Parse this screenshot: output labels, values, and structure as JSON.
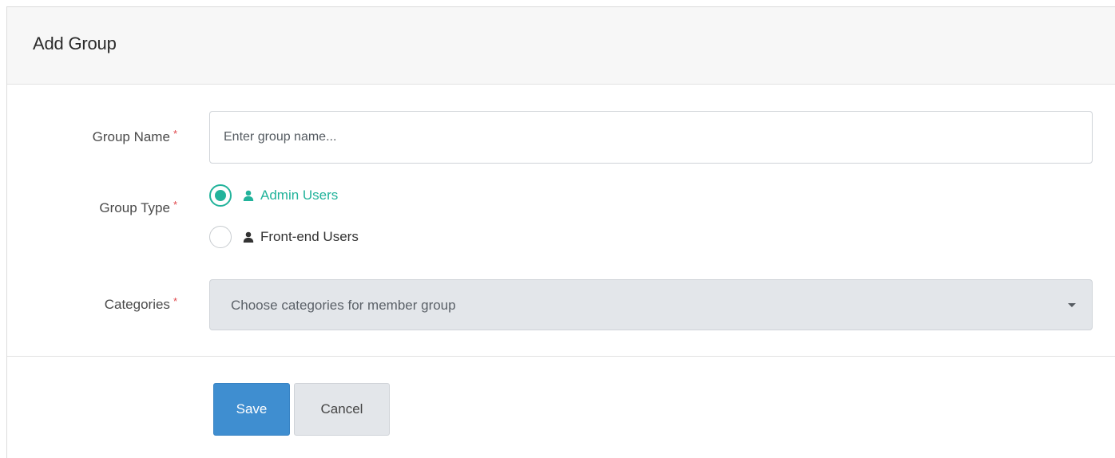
{
  "header": {
    "title": "Add Group"
  },
  "form": {
    "group_name": {
      "label": "Group Name",
      "required_mark": "*",
      "placeholder": "Enter group name...",
      "value": ""
    },
    "group_type": {
      "label": "Group Type",
      "required_mark": "*",
      "options": [
        {
          "label": "Admin Users",
          "icon": "user-icon",
          "selected": true
        },
        {
          "label": "Front-end Users",
          "icon": "user-icon",
          "selected": false
        }
      ]
    },
    "categories": {
      "label": "Categories",
      "required_mark": "*",
      "placeholder": "Choose categories for member group"
    }
  },
  "actions": {
    "save_label": "Save",
    "cancel_label": "Cancel"
  },
  "colors": {
    "accent": "#22b39b",
    "primary_button": "#3f8ed0",
    "required": "#e0474c",
    "select_bg": "#e3e6ea"
  }
}
